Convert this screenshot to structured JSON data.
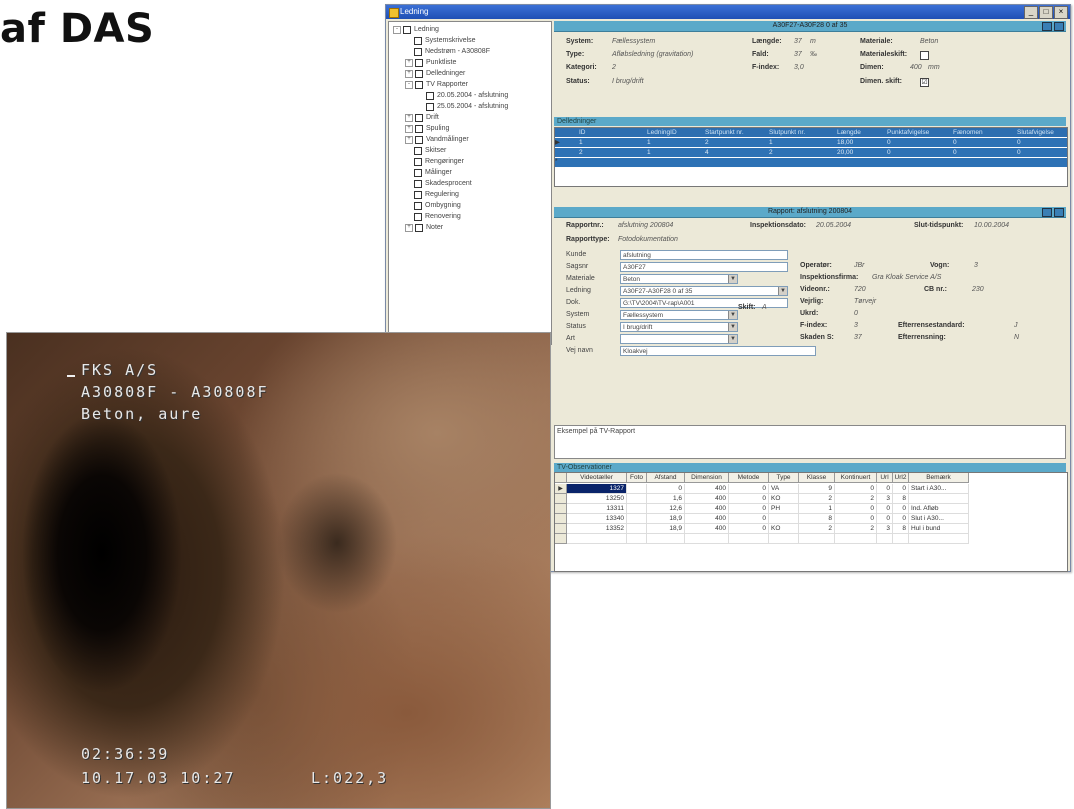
{
  "heading": "af DAS",
  "window": {
    "title": "Ledning",
    "controls": [
      "_",
      "□",
      "×"
    ]
  },
  "tree": {
    "items": [
      {
        "label": "Ledning",
        "level": 0,
        "expander": "-"
      },
      {
        "label": "Systemskrivelse",
        "level": 1,
        "expander": ""
      },
      {
        "label": "Nedstrøm - A30808F",
        "level": 1,
        "expander": ""
      },
      {
        "label": "Punktliste",
        "level": 1,
        "expander": "+"
      },
      {
        "label": "Delledninger",
        "level": 1,
        "expander": "+"
      },
      {
        "label": "TV Rapporter",
        "level": 1,
        "expander": "-"
      },
      {
        "label": "20.05.2004 - afslutning",
        "level": 2,
        "expander": ""
      },
      {
        "label": "25.05.2004 - afslutning",
        "level": 2,
        "expander": ""
      },
      {
        "label": "Drift",
        "level": 1,
        "expander": "+"
      },
      {
        "label": "Spuling",
        "level": 1,
        "expander": "+"
      },
      {
        "label": "Vandmålinger",
        "level": 1,
        "expander": "+"
      },
      {
        "label": "Skitser",
        "level": 1,
        "expander": ""
      },
      {
        "label": "Rengøringer",
        "level": 1,
        "expander": ""
      },
      {
        "label": "Målinger",
        "level": 1,
        "expander": ""
      },
      {
        "label": "Skadesprocent",
        "level": 1,
        "expander": ""
      },
      {
        "label": "Regulering",
        "level": 1,
        "expander": ""
      },
      {
        "label": "Ombygning",
        "level": 1,
        "expander": ""
      },
      {
        "label": "Renovering",
        "level": 1,
        "expander": ""
      },
      {
        "label": "Noter",
        "level": 1,
        "expander": "+"
      }
    ]
  },
  "ledning_panel": {
    "header": "A30F27-A30F28 0 af 35",
    "fields": [
      {
        "label": "System:",
        "value": "Fællessystem"
      },
      {
        "label": "Type:",
        "value": "Afløbsledning (gravitation)"
      },
      {
        "label": "Kategori:",
        "value": "2"
      },
      {
        "label": "Status:",
        "value": "I brug/drift"
      },
      {
        "label": "Længde:",
        "value": "37",
        "unit": "m"
      },
      {
        "label": "Fald:",
        "value": "37",
        "unit": "‰"
      },
      {
        "label": "F-index:",
        "value": "3,0"
      },
      {
        "label": "Materiale:",
        "value": "Beton"
      },
      {
        "label": "Materialeskift:",
        "value": ""
      },
      {
        "label": "Dimen:",
        "value": "400",
        "unit": "mm"
      },
      {
        "label": "Dimen. skift:",
        "value": "☑"
      }
    ]
  },
  "delledninger": {
    "title": "Delledninger",
    "columns": [
      "ID",
      "LedningID",
      "Startpunkt nr.",
      "Slutpunkt nr.",
      "Længde",
      "Punktafvigelse",
      "Fænomen",
      "Slutafvigelse"
    ],
    "rows": [
      [
        "1",
        "1",
        "2",
        "1",
        "18,00",
        "0",
        "0",
        "0"
      ],
      [
        "2",
        "1",
        "4",
        "2",
        "20,00",
        "0",
        "0",
        "0"
      ]
    ]
  },
  "rapport_panel": {
    "header": "Rapport: afslutning 200804",
    "rapportnr_label": "Rapportnr.:",
    "rapportnr_value": "afslutning 200804",
    "insp_label": "Inspektionsdato:",
    "insp_value": "20.05.2004",
    "slut_label": "Slut-tidspunkt:",
    "slut_value": "10.00.2004",
    "rapporttype_label": "Rapporttype:",
    "rapporttype_value": "Fotodokumentation",
    "form": [
      {
        "label": "Kunde",
        "value": "afslutning",
        "select": false
      },
      {
        "label": "Sagsnr",
        "value": "A30F27",
        "select": false
      },
      {
        "label": "Materiale",
        "value": "Beton",
        "select": true
      },
      {
        "label": "Ledning",
        "value": "A30F27-A30F28 0 af 35",
        "select": true
      },
      {
        "label": "Dok.",
        "value": "G:\\TV\\2004\\TV-rap\\A001",
        "select": false
      },
      {
        "label": "System",
        "value": "Fællessystem",
        "select": true
      },
      {
        "label": "Status",
        "value": "I brug/drift",
        "select": true
      },
      {
        "label": "Art",
        "value": "",
        "select": true
      },
      {
        "label": "Vej navn",
        "value": "Kloakvej",
        "select": false
      }
    ],
    "skift_label": "Skift:",
    "skift_value": "A",
    "info": [
      {
        "label": "Operatør:",
        "value": "JBr"
      },
      {
        "label": "Inspektionsfirma:",
        "value": "Gra Kloak Service A/S"
      },
      {
        "label": "Videonr.:",
        "value": "720"
      },
      {
        "label": "Vejrlig:",
        "value": "Tørvejr"
      },
      {
        "label": "Ukrd:",
        "value": "0"
      },
      {
        "label": "F-index:",
        "value": "3"
      },
      {
        "label": "Skaden S:",
        "value": "37"
      }
    ],
    "info2": [
      {
        "label": "Vogn:",
        "value": "3"
      },
      {
        "label": "CB nr.:",
        "value": "230"
      },
      {
        "label": "Efterrensestandard:",
        "value": "J"
      },
      {
        "label": "Efterrensning:",
        "value": "N"
      }
    ]
  },
  "memo_text": "Eksempel på TV-Rapport",
  "tv_table": {
    "title": "TV-Observationer",
    "columns": [
      "Videotæller",
      "Foto",
      "Afstand",
      "Dimension",
      "Metode",
      "Type",
      "Klasse",
      "Kontinuert",
      "Url",
      "Url2",
      "Bemærk"
    ],
    "rows": [
      [
        "1327",
        "",
        "0",
        "400",
        "0",
        "VA",
        "9",
        "0",
        "0",
        "0",
        "Start i A30..."
      ],
      [
        "13250",
        "",
        "1,6",
        "400",
        "0",
        "KO",
        "2",
        "2",
        "3",
        "8",
        ""
      ],
      [
        "13311",
        "",
        "12,6",
        "400",
        "0",
        "PH",
        "1",
        "0",
        "0",
        "0",
        "Ind. Afløb"
      ],
      [
        "13340",
        "",
        "18,9",
        "400",
        "0",
        "",
        "8",
        "0",
        "0",
        "0",
        "Slut i A30..."
      ],
      [
        "13352",
        "",
        "18,9",
        "400",
        "0",
        "KO",
        "2",
        "2",
        "3",
        "8",
        "Hul i bund"
      ],
      [
        "",
        "",
        "",
        "",
        "",
        "",
        "",
        "",
        "",
        "",
        ""
      ]
    ]
  },
  "camera": {
    "line1": "FKS A/S",
    "line2": "A30808F - A30808F",
    "line3": "Beton, aure",
    "line4": "02:36:39",
    "line5": "10.17.03 10:27",
    "line5b": "L:022,3"
  }
}
